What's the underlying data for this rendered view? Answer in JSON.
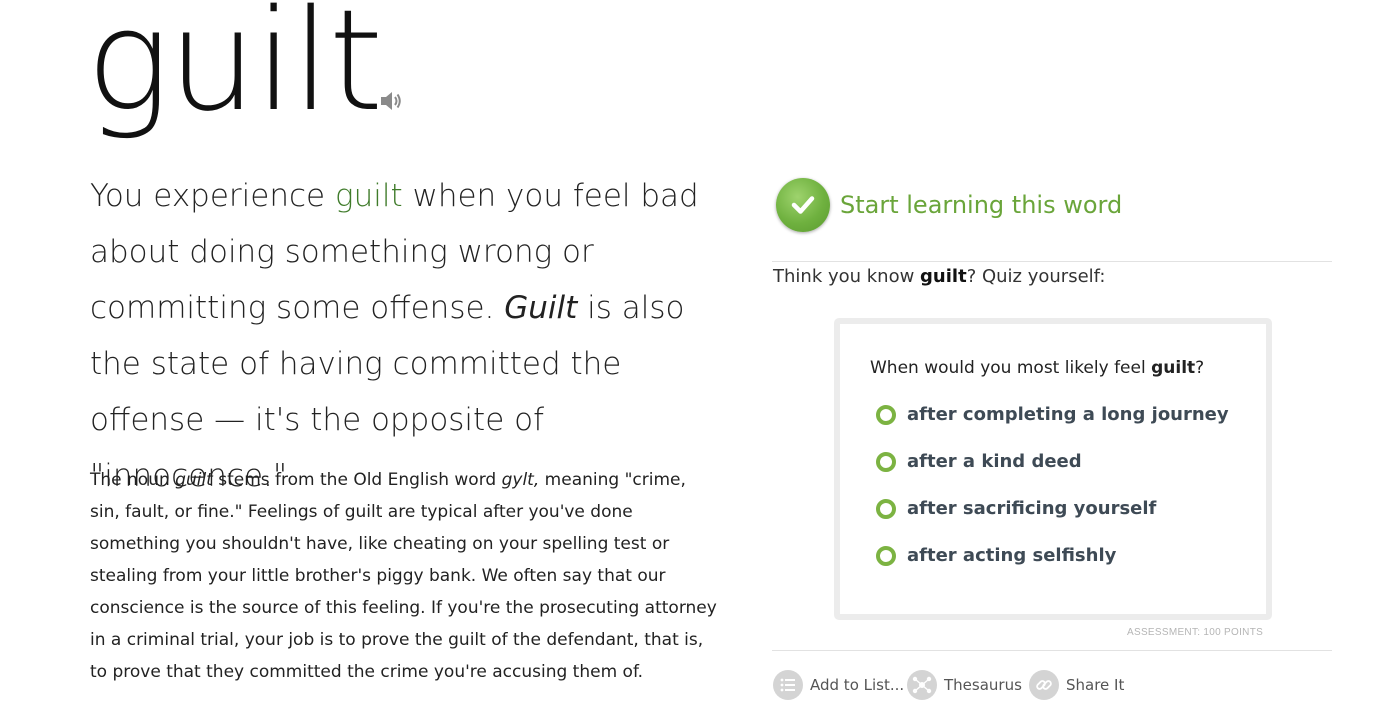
{
  "word": "guilt",
  "short_definition": {
    "part1": "You experience ",
    "word_highlight": "guilt",
    "part2": " when you feel bad about doing something wrong or committing some offense. ",
    "word_italic": "Guilt",
    "part3": " is also the state of having committed the offense — it's the opposite of \"innocence.\""
  },
  "long_definition": {
    "part1": "The noun ",
    "italic1": "guilt",
    "part2": " stems from the Old English word ",
    "italic2": "gylt,",
    "part3": " meaning \"crime, sin, fault, or fine.\" Feelings of guilt are typical after you've done something you shouldn't have, like cheating on your spelling test or stealing from your little brother's piggy bank. We often say that our conscience is the source of this feeling. If you're the prosecuting attorney in a criminal trial, your job is to prove the guilt of the defendant, that is, to prove that they committed the crime you're accusing them of."
  },
  "learn": {
    "label": "Start learning this word"
  },
  "quiz": {
    "prompt_before": "Think you know ",
    "prompt_word": "guilt",
    "prompt_after": "? Quiz yourself:",
    "question_before": "When would you most likely feel ",
    "question_word": "guilt",
    "question_after": "?",
    "choices": [
      "after completing a long journey",
      "after a kind deed",
      "after sacrificing yourself",
      "after acting selfishly"
    ],
    "assessment_label": "ASSESSMENT: 100 POINTS"
  },
  "actions": {
    "add_to_list": "Add to List...",
    "thesaurus": "Thesaurus",
    "share": "Share It"
  },
  "colors": {
    "accent_green": "#6aa53a",
    "radio_green": "#7cb342",
    "word_highlight": "#3f7b2a"
  }
}
